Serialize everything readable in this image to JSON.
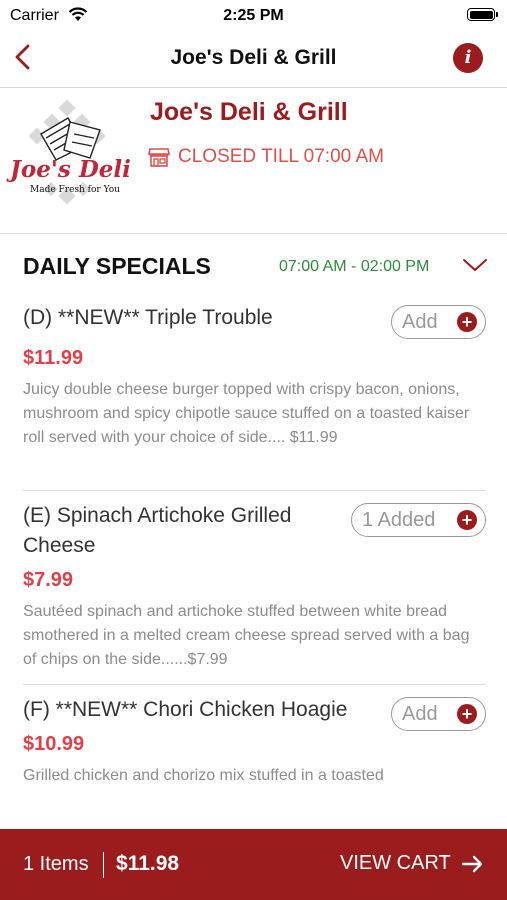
{
  "status_bar": {
    "carrier": "Carrier",
    "time": "2:25 PM"
  },
  "nav": {
    "title": "Joe's Deli & Grill",
    "info_icon": "i"
  },
  "restaurant": {
    "name": "Joe's Deli & Grill",
    "status": "CLOSED TILL 07:00 AM",
    "logo": {
      "title": "Joe's Deli",
      "tagline": "Made Fresh for You"
    }
  },
  "section": {
    "title": "DAILY SPECIALS",
    "hours": "07:00 AM - 02:00 PM"
  },
  "items": [
    {
      "name": "(D) **NEW** Triple Trouble",
      "price": "$11.99",
      "description": "Juicy double cheese burger topped with crispy bacon, onions, mushroom and spicy chipotle sauce stuffed on a toasted kaiser roll served with your choice of side.... $11.99",
      "button": "Add"
    },
    {
      "name": "(E)  Spinach Artichoke Grilled Cheese",
      "price": "$7.99",
      "description": "Sautéed spinach and artichoke stuffed between white bread smothered in a melted cream cheese spread served with a bag of chips on the side......$7.99",
      "button": "1 Added"
    },
    {
      "name": "(F) **NEW** Chori Chicken Hoagie",
      "price": "$10.99",
      "description": "Grilled chicken and chorizo mix stuffed in a toasted",
      "button": "Add"
    }
  ],
  "cart": {
    "items": "1 Items",
    "total": "$11.98",
    "view": "VIEW CART"
  },
  "colors": {
    "brand": "#9b1c1c",
    "price": "#e0404a",
    "hours": "#2e8b3e",
    "closed": "#e0504a"
  },
  "icons": {
    "back": "chevron-left-icon",
    "info": "info-icon",
    "store": "store-icon",
    "expand": "chevron-down-icon",
    "add": "plus-icon",
    "cart_arrow": "arrow-right-icon"
  }
}
